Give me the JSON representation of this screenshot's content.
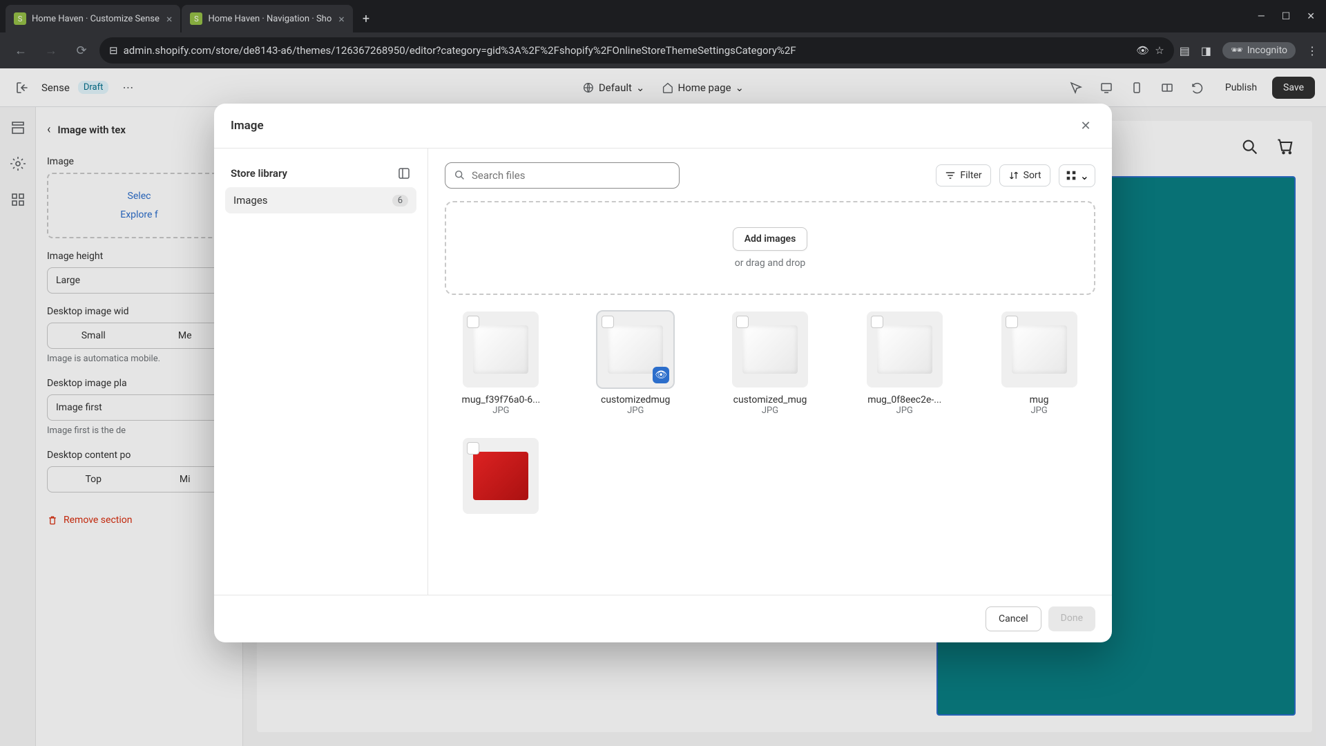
{
  "browser": {
    "tabs": [
      {
        "title": "Home Haven · Customize Sense"
      },
      {
        "title": "Home Haven · Navigation · Sho"
      }
    ],
    "url": "admin.shopify.com/store/de8143-a6/themes/126367268950/editor?category=gid%3A%2F%2Fshopify%2FOnlineStoreThemeSettingsCategory%2F",
    "incognito": "Incognito"
  },
  "appbar": {
    "theme": "Sense",
    "status": "Draft",
    "viewport": "Default",
    "page": "Home page",
    "publish": "Publish",
    "save": "Save"
  },
  "sidebar": {
    "title": "Image with tex",
    "image_label": "Image",
    "select_image": "Selec",
    "explore": "Explore f",
    "height_label": "Image height",
    "height_value": "Large",
    "width_label": "Desktop image wid",
    "width_opts": [
      "Small",
      "Me"
    ],
    "width_help": "Image is automatica mobile.",
    "placement_label": "Desktop image pla",
    "placement_value": "Image first",
    "placement_help": "Image first is the de",
    "content_label": "Desktop content po",
    "content_opts": [
      "Top",
      "Mi"
    ],
    "remove": "Remove section"
  },
  "modal": {
    "title": "Image",
    "sidebar": {
      "library": "Store library",
      "images": "Images",
      "count": "6"
    },
    "search_placeholder": "Search files",
    "filter": "Filter",
    "sort": "Sort",
    "upload": {
      "button": "Add images",
      "hint": "or drag and drop"
    },
    "files": [
      {
        "name": "mug_f39f76a0-6...",
        "ext": "JPG",
        "hovered": false,
        "kind": "mug"
      },
      {
        "name": "customizedmug",
        "ext": "JPG",
        "hovered": true,
        "kind": "mug"
      },
      {
        "name": "customized_mug",
        "ext": "JPG",
        "hovered": false,
        "kind": "mug"
      },
      {
        "name": "mug_0f8eec2e-...",
        "ext": "JPG",
        "hovered": false,
        "kind": "mug"
      },
      {
        "name": "mug",
        "ext": "JPG",
        "hovered": false,
        "kind": "mug"
      },
      {
        "name": "",
        "ext": "",
        "hovered": false,
        "kind": "gift"
      }
    ],
    "cancel": "Cancel",
    "done": "Done"
  }
}
